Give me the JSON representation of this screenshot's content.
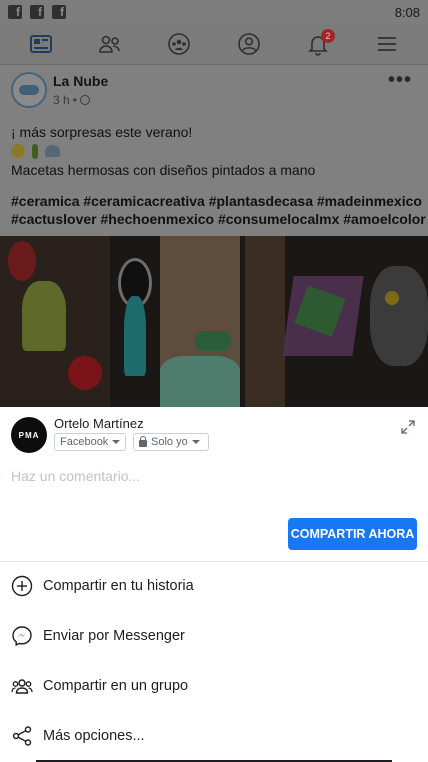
{
  "status_bar": {
    "time": "8:08",
    "icons": [
      "facebook-icon",
      "facebook-icon",
      "facebook-icon"
    ]
  },
  "nav": {
    "items": [
      {
        "name": "news-feed",
        "icon": "news-feed-icon"
      },
      {
        "name": "friends",
        "icon": "friends-icon"
      },
      {
        "name": "groups",
        "icon": "groups-icon"
      },
      {
        "name": "profile",
        "icon": "profile-icon"
      },
      {
        "name": "notifications",
        "icon": "bell-icon",
        "badge": "2"
      },
      {
        "name": "menu",
        "icon": "hamburger-icon"
      }
    ]
  },
  "post": {
    "author": "La Nube",
    "time": "3 h",
    "separator": "•",
    "line1": "¡ más sorpresas este verano!",
    "emojis": [
      "sun",
      "cactus",
      "shell"
    ],
    "line2": "Macetas hermosas con diseños pintados a mano",
    "hashtags": "#ceramica #ceramicacreativa #plantasdecasa #madeinmexico #cactuslover #hechoenmexico #consumelocalmx #amoelcolor",
    "more": "•••"
  },
  "share": {
    "user": "Ortelo Martínez",
    "avatar_text": "PMA",
    "destination": "Facebook",
    "audience": "Solo yo",
    "comment_placeholder": "Haz un comentario...",
    "share_now": "COMPARTIR AHORA",
    "options": [
      {
        "label": "Compartir en tu historia",
        "icon": "add-circle-icon"
      },
      {
        "label": "Enviar por Messenger",
        "icon": "messenger-icon"
      },
      {
        "label": "Compartir en un grupo",
        "icon": "group-icon"
      },
      {
        "label": "Más opciones...",
        "icon": "share-icon"
      }
    ]
  },
  "colors": {
    "accent": "#1877f2",
    "overlay": "#808080",
    "badge": "#a0262a"
  }
}
